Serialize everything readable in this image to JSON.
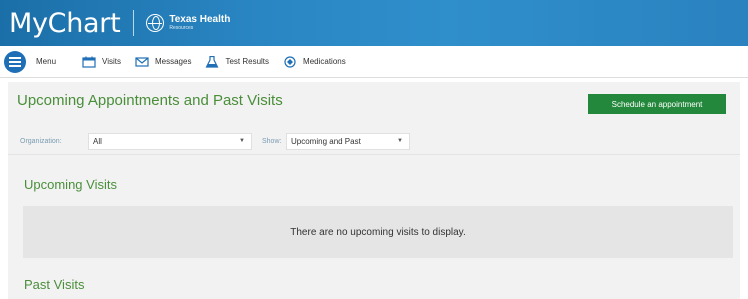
{
  "header": {
    "app_title": "MyChart",
    "brand_name": "Texas Health",
    "brand_sub": "Resources"
  },
  "nav": {
    "items": [
      {
        "label": "Menu",
        "icon": "menu-icon"
      },
      {
        "label": "Visits",
        "icon": "calendar-icon"
      },
      {
        "label": "Messages",
        "icon": "envelope-icon"
      },
      {
        "label": "Test Results",
        "icon": "flask-icon"
      },
      {
        "label": "Medications",
        "icon": "pill-icon"
      }
    ]
  },
  "page": {
    "title": "Upcoming Appointments and Past Visits",
    "schedule_button": "Schedule an appointment"
  },
  "filters": {
    "organization_label": "Organization:",
    "organization_value": "All",
    "show_label": "Show:",
    "show_value": "Upcoming and Past"
  },
  "sections": {
    "upcoming_title": "Upcoming Visits",
    "upcoming_empty": "There are no upcoming visits to display.",
    "past_title": "Past Visits"
  },
  "colors": {
    "header_blue": "#2a86c3",
    "accent_green": "#4a8e3a",
    "button_green": "#23873c"
  }
}
